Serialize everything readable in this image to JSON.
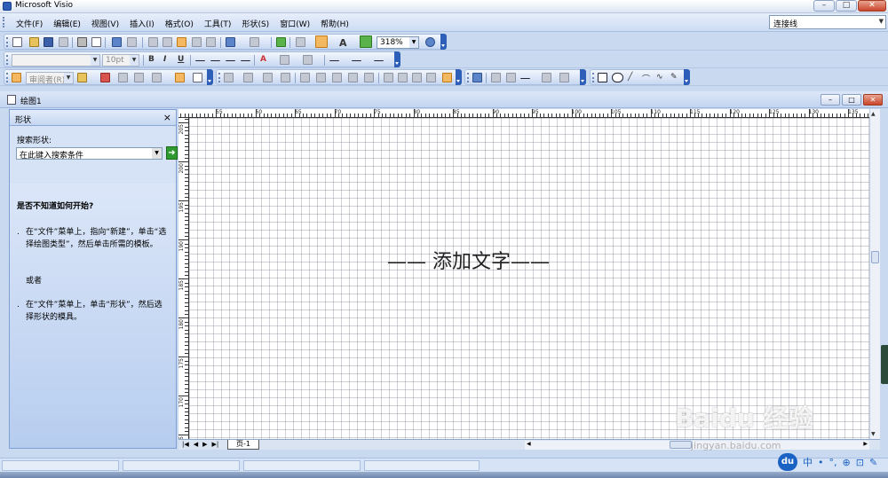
{
  "app": {
    "title": "Microsoft Visio",
    "window_buttons": [
      "–",
      "□",
      "✕"
    ]
  },
  "menu": {
    "items": [
      "文件(F)",
      "编辑(E)",
      "视图(V)",
      "插入(I)",
      "格式(O)",
      "工具(T)",
      "形状(S)",
      "窗口(W)",
      "帮助(H)"
    ],
    "help_box_value": "连接线"
  },
  "toolbar": {
    "zoom": "318%",
    "font_size": "10pt",
    "font_name": "",
    "review_label": "审阅者(R)"
  },
  "document": {
    "title": "绘图1",
    "window_buttons": [
      "–",
      "□",
      "✕"
    ]
  },
  "shapes_pane": {
    "title": "形状",
    "close": "×",
    "search_label": "搜索形状:",
    "search_value": "在此键入搜索条件",
    "help_question": "是否不知道如何开始?",
    "bullet1": "在“文件”菜单上，指向“新建”，单击“选择绘图类型”，然后单击所需的模板。",
    "or_text": "或者",
    "bullet2": "在“文件”菜单上，单击“形状”，然后选择形状的模具。"
  },
  "canvas": {
    "text": "—— 添加文字——",
    "hruler_labels": [
      "55",
      "60",
      "65",
      "70",
      "75",
      "80",
      "85",
      "90",
      "95",
      "100",
      "105",
      "110",
      "115",
      "120",
      "125",
      "130",
      "135"
    ],
    "vruler_labels": [
      "205",
      "200",
      "195",
      "190",
      "185",
      "180",
      "175",
      "170",
      "165"
    ]
  },
  "page": {
    "tab_label": "页-1",
    "nav": [
      "|◀",
      "◀",
      "▶",
      "▶|"
    ]
  },
  "ime": {
    "logo": "du",
    "mode": "中",
    "symbols": [
      "•",
      "°,",
      "⊕",
      "⊡",
      "✎"
    ]
  },
  "watermark": {
    "brand": "Baidu 经验",
    "url": "jingyan.baidu.com"
  }
}
